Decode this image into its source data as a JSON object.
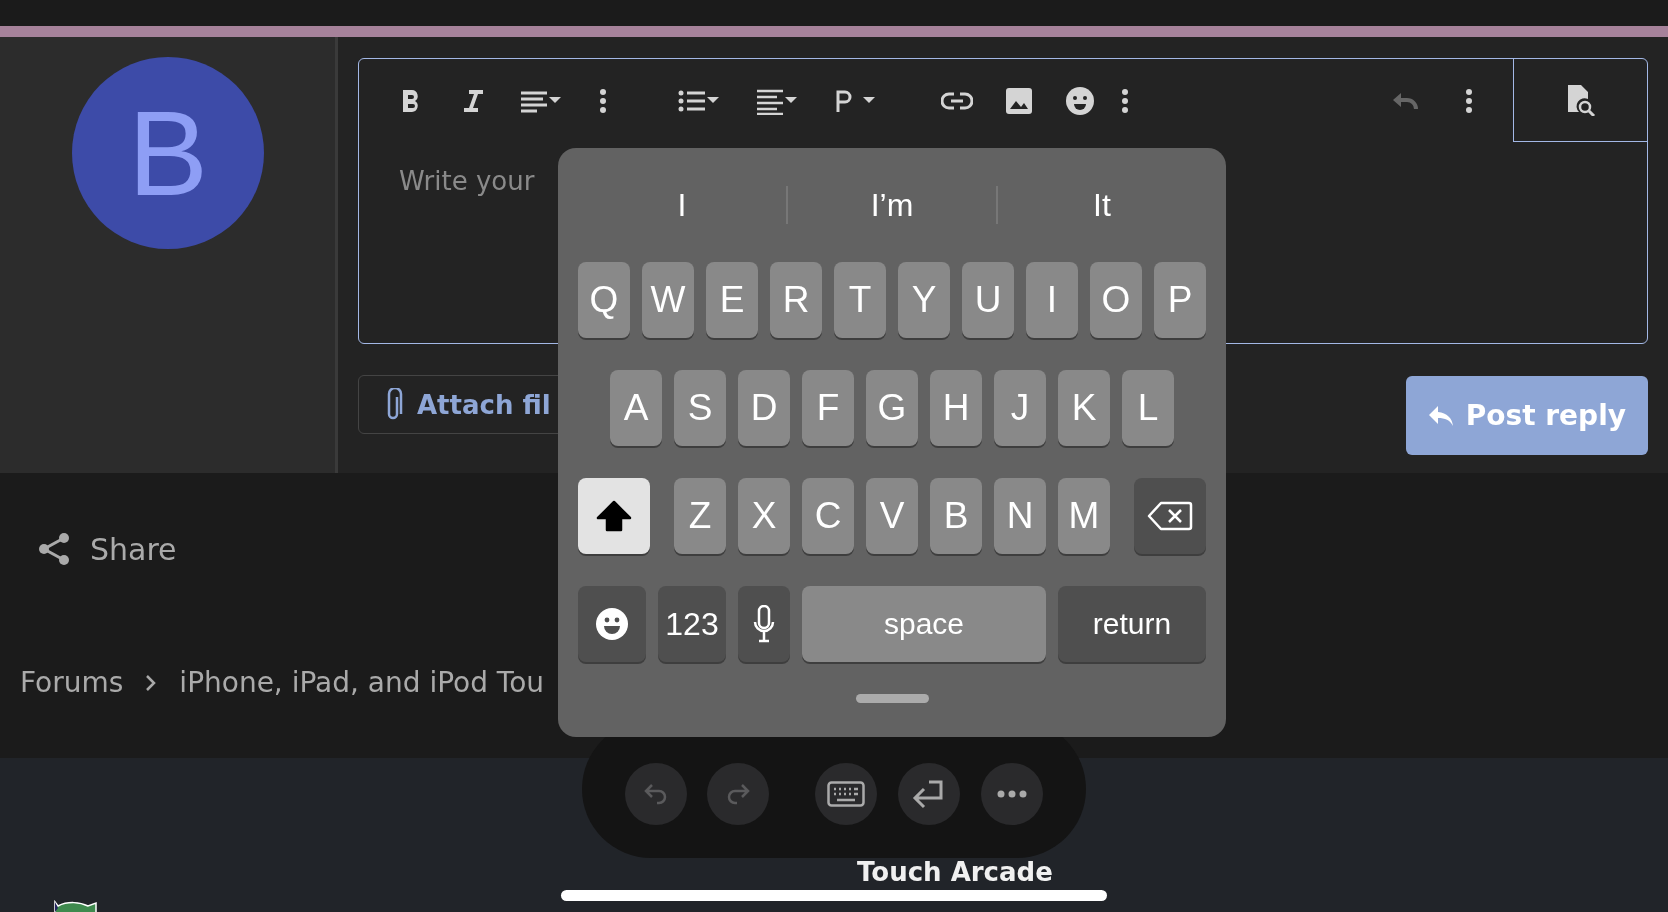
{
  "avatar": {
    "letter": "B"
  },
  "editor": {
    "undo": {
      "disabled": true
    },
    "placeholder": "Write your"
  },
  "attach_button": "Attach fil",
  "post_button": "Post reply",
  "share": "Share",
  "breadcrumb": [
    "Forums",
    "iPhone, iPad, and iPod Tou"
  ],
  "keyboard": {
    "suggestions": [
      "I",
      "I’m",
      "It"
    ],
    "rows": [
      [
        "Q",
        "W",
        "E",
        "R",
        "T",
        "Y",
        "U",
        "I",
        "O",
        "P"
      ],
      [
        "A",
        "S",
        "D",
        "F",
        "G",
        "H",
        "J",
        "K",
        "L"
      ],
      [
        "Z",
        "X",
        "C",
        "V",
        "B",
        "N",
        "M"
      ]
    ],
    "shift": {
      "on": true
    },
    "numbers_key": "123",
    "space_key": "space",
    "return_key": "return"
  },
  "floating_toolbar": {
    "undo": {
      "disabled": true
    },
    "redo": {
      "disabled": true
    }
  },
  "footer": {
    "title": "Touch Arcade"
  }
}
